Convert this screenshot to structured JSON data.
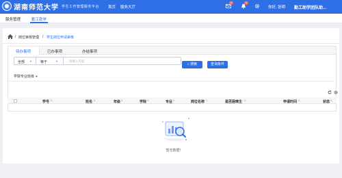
{
  "header": {
    "brand_name": "湖南师范大学",
    "brand_subtitle": "学生工作管理服务平台",
    "nav": [
      "首页",
      "服务大厅"
    ],
    "mail_badge": "2",
    "bell_badge": "1",
    "greeting": "你好, 张明",
    "role": "勤工助学团队助..."
  },
  "module_tabs": [
    "服务管理",
    "勤工助学"
  ],
  "breadcrumb": [
    "岗位审核管理",
    "学生岗位申请审核"
  ],
  "tabs": [
    "待办事项",
    "已办事项",
    "办结事项"
  ],
  "search": {
    "scope": "全部",
    "operator": "等于",
    "placeholder": "请输入内容",
    "search_label": "搜索",
    "query_label": "查询条件"
  },
  "filter": {
    "label": "学院专业班级"
  },
  "table": {
    "columns": [
      "学号",
      "姓名",
      "年级",
      "学院",
      "专业",
      "岗位名称",
      "是否困难生",
      "申请时间",
      "状态"
    ]
  },
  "empty_text": "暂无数据！",
  "colors": {
    "primary": "#2f6fe5",
    "badge": "#f56c6c"
  }
}
